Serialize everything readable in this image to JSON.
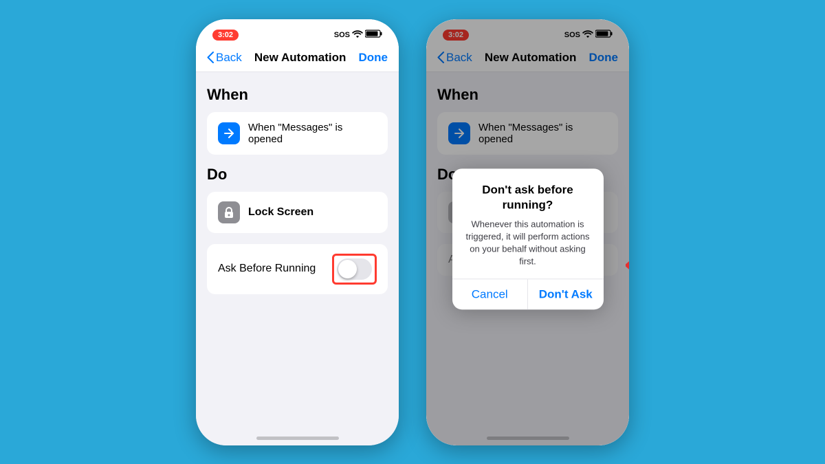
{
  "background_color": "#2aa8d8",
  "phone_left": {
    "status_bar": {
      "time": "3:02",
      "sos": "SOS",
      "wifi_icon": "wifi",
      "battery_icon": "battery"
    },
    "nav": {
      "back_label": "Back",
      "title": "New Automation",
      "done_label": "Done"
    },
    "when_section": {
      "title": "When",
      "trigger_card": {
        "icon": "↗",
        "text": "When \"Messages\" is opened"
      }
    },
    "do_section": {
      "title": "Do",
      "action_card": {
        "icon": "🔒",
        "text": "Lock Screen"
      }
    },
    "ask_row": {
      "label": "Ask Before Running",
      "toggle_state": "off"
    }
  },
  "phone_right": {
    "status_bar": {
      "time": "3:02",
      "sos": "SOS"
    },
    "nav": {
      "back_label": "Back",
      "title": "New Automation",
      "done_label": "Done"
    },
    "when_section": {
      "title": "When",
      "trigger_card": {
        "text": "When \"Messages\" is opened"
      }
    },
    "do_section": {
      "title": "Do"
    },
    "ask_row": {
      "label": "Ask"
    },
    "dialog": {
      "title": "Don't ask before running?",
      "message": "Whenever this automation is triggered, it will perform actions on your behalf without asking first.",
      "cancel_label": "Cancel",
      "confirm_label": "Don't Ask"
    }
  }
}
